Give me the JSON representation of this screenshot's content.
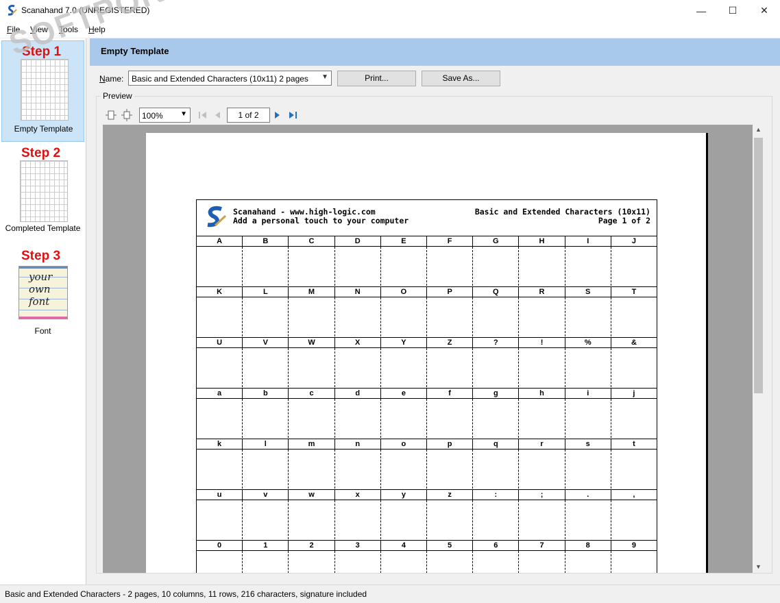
{
  "window": {
    "title": "Scanahand 7.0 (UNREGISTERED)",
    "minimize_glyph": "—",
    "maximize_glyph": "☐",
    "close_glyph": "✕"
  },
  "menu": [
    {
      "label": "File",
      "accel": "F",
      "rest": "ile"
    },
    {
      "label": "View",
      "accel": "V",
      "rest": "iew"
    },
    {
      "label": "Tools",
      "accel": "T",
      "rest": "ools"
    },
    {
      "label": "Help",
      "accel": "H",
      "rest": "elp"
    }
  ],
  "steps": [
    {
      "step": "Step 1",
      "caption": "Empty Template",
      "selected": true
    },
    {
      "step": "Step 2",
      "caption": "Completed Template",
      "selected": false
    },
    {
      "step": "Step 3",
      "caption": "Font",
      "selected": false
    }
  ],
  "font_thumb_lines": [
    "your",
    "own",
    "font"
  ],
  "header": {
    "title": "Empty Template"
  },
  "name_row": {
    "label": "Name:",
    "selected": "Basic and Extended Characters (10x11) 2 pages",
    "print_label": "Print...",
    "saveas_label": "Save As..."
  },
  "preview": {
    "group_label": "Preview",
    "zoom": "100%",
    "page_indicator": "1 of 2"
  },
  "sheet": {
    "left_title": "Scanahand - www.high-logic.com",
    "left_subtitle": "Add a personal touch to your computer",
    "right_title": "Basic and Extended Characters (10x11)",
    "right_subtitle": "Page 1 of 2",
    "rows": [
      [
        "A",
        "B",
        "C",
        "D",
        "E",
        "F",
        "G",
        "H",
        "I",
        "J"
      ],
      [
        "K",
        "L",
        "M",
        "N",
        "O",
        "P",
        "Q",
        "R",
        "S",
        "T"
      ],
      [
        "U",
        "V",
        "W",
        "X",
        "Y",
        "Z",
        "?",
        "!",
        "%",
        "&"
      ],
      [
        "a",
        "b",
        "c",
        "d",
        "e",
        "f",
        "g",
        "h",
        "i",
        "j"
      ],
      [
        "k",
        "l",
        "m",
        "n",
        "o",
        "p",
        "q",
        "r",
        "s",
        "t"
      ],
      [
        "u",
        "v",
        "w",
        "x",
        "y",
        "z",
        ":",
        ";",
        ".",
        ","
      ],
      [
        "0",
        "1",
        "2",
        "3",
        "4",
        "5",
        "6",
        "7",
        "8",
        "9"
      ]
    ]
  },
  "status": "Basic and Extended Characters - 2 pages, 10 columns, 11 rows, 216 characters, signature included",
  "watermark": "SOFTPORTAL",
  "colors": {
    "header_band": "#a8c8ec",
    "step_label": "#e01010",
    "selection": "#cce4f7"
  }
}
